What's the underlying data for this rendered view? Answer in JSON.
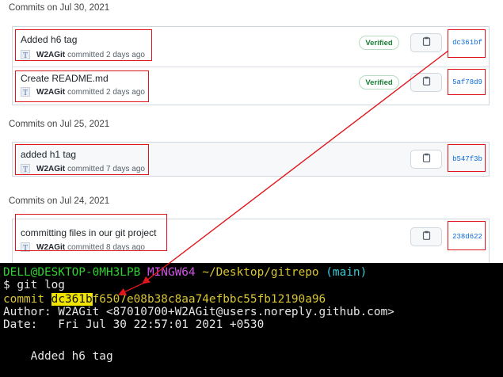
{
  "groups": [
    {
      "date": "Commits on Jul 30, 2021",
      "commits": [
        {
          "title": "Added h6 tag",
          "author": "W2AGit",
          "time": "committed 2 days ago",
          "verified": "Verified",
          "sha": "dc361bf"
        },
        {
          "title": "Create README.md",
          "author": "W2AGit",
          "time": "committed 2 days ago",
          "verified": "Verified",
          "sha": "5af78d9"
        }
      ]
    },
    {
      "date": "Commits on Jul 25, 2021",
      "commits": [
        {
          "title": "added h1 tag",
          "author": "W2AGit",
          "time": "committed 7 days ago",
          "sha": "b547f3b"
        }
      ]
    },
    {
      "date": "Commits on Jul 24, 2021",
      "commits": [
        {
          "title": "committing files in our git project",
          "author": "W2AGit",
          "time": "committed 8 days ago",
          "sha": "238d622"
        }
      ]
    }
  ],
  "terminal": {
    "prompt_user": "DELL@DESKTOP-0MH3LPB",
    "prompt_env": "MINGW64",
    "prompt_path": "~/Desktop/gitrepo",
    "prompt_branch": "(main)",
    "command": "$ git log",
    "commit_label": "commit ",
    "commit_hash_highlight": "dc361b",
    "commit_hash_rest": "f6507e08b38c8aa74efbbc55fb12190a96",
    "author_line": "Author: W2AGit <87010700+W2AGit@users.noreply.github.com>",
    "date_line": "Date:   Fri Jul 30 22:57:01 2021 +0530",
    "message_line": "    Added h6 tag"
  },
  "colors": {
    "annotation": "#e0151c",
    "verified": "#1a7f37",
    "sha_link": "#0969da"
  }
}
